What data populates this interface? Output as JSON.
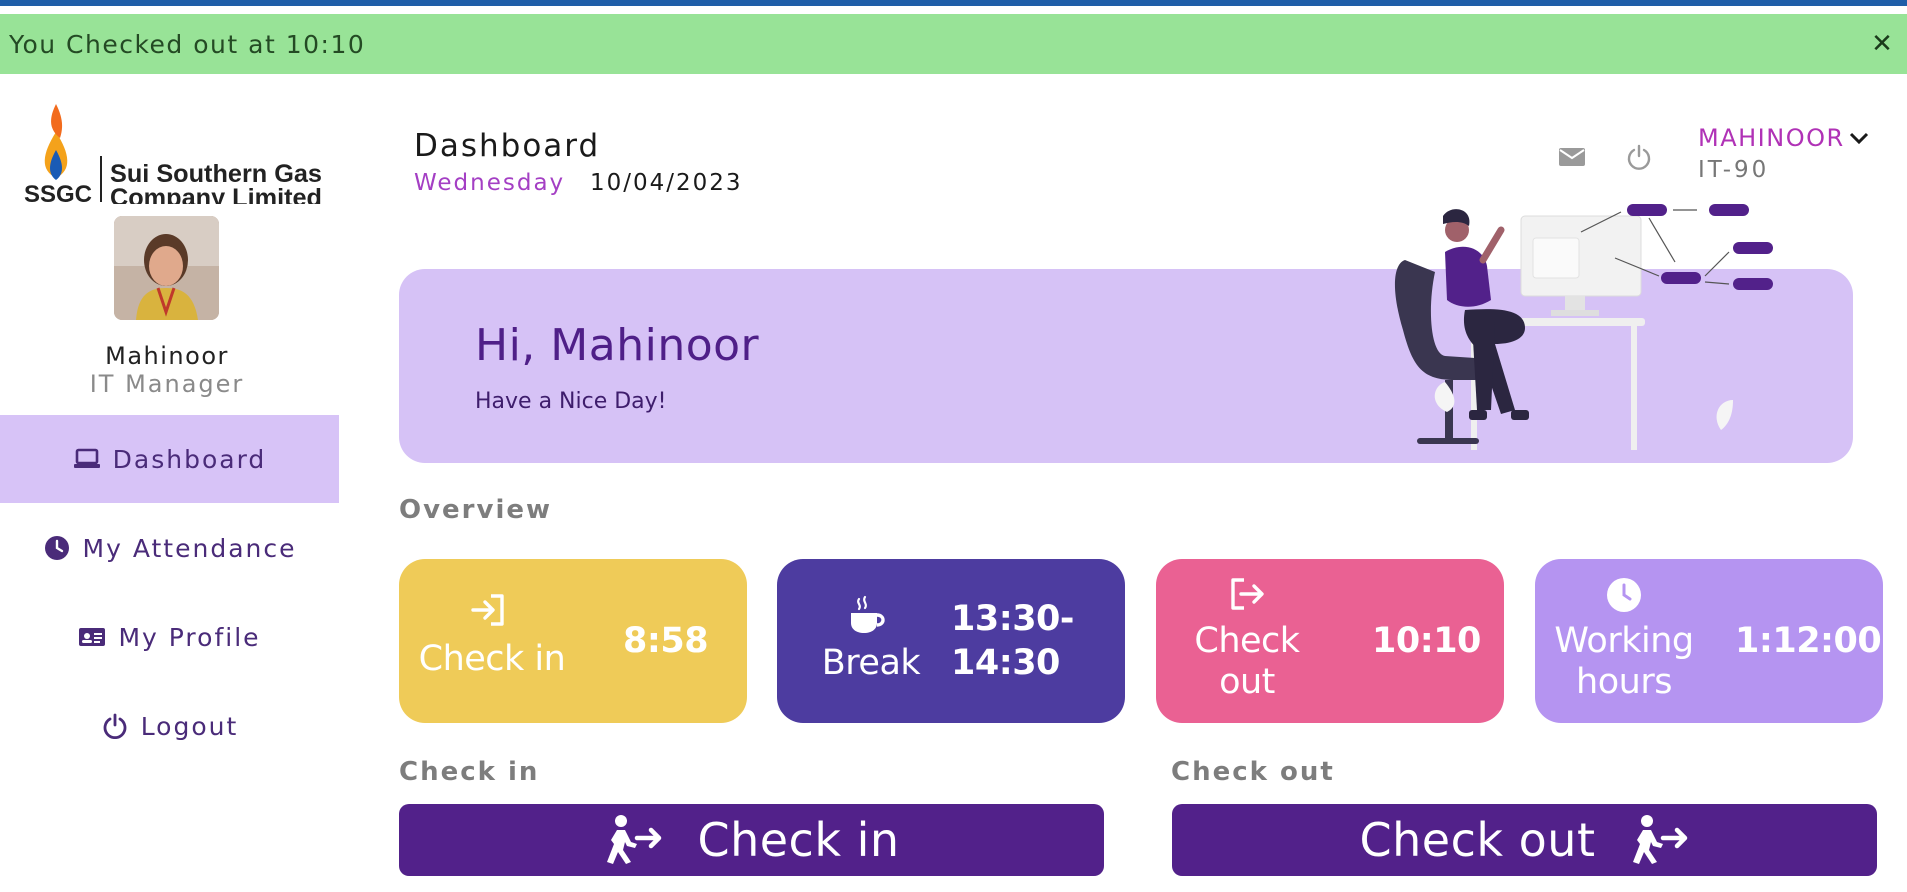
{
  "alert": {
    "message": "You Checked out at 10:10",
    "close_label": "✕"
  },
  "sidebar": {
    "logo": {
      "abbr": "SSGC",
      "line1": "Sui Southern Gas",
      "line2": "Company Limited"
    },
    "user_name": "Mahinoor",
    "user_role": "IT Manager",
    "items": [
      {
        "label": "Dashboard",
        "icon": "laptop-icon",
        "active": true
      },
      {
        "label": "My Attendance",
        "icon": "clock-icon",
        "active": false
      },
      {
        "label": "My Profile",
        "icon": "id-card-icon",
        "active": false
      },
      {
        "label": "Logout",
        "icon": "power-icon",
        "active": false
      }
    ]
  },
  "header": {
    "title": "Dashboard",
    "day": "Wednesday",
    "date": "10/04/2023",
    "user_name": "MAHINOOR",
    "user_id": "IT-90"
  },
  "hero": {
    "greeting": "Hi, Mahinoor",
    "subtitle": "Have a Nice Day!"
  },
  "overview": {
    "title": "Overview",
    "cards": [
      {
        "label": "Check in",
        "value": "8:58",
        "icon": "sign-in-icon",
        "color": "#efcb58"
      },
      {
        "label": "Break",
        "value_line1": "13:30-",
        "value_line2": "14:30",
        "icon": "coffee-icon",
        "color": "#4d3ca0"
      },
      {
        "label_line1": "Check",
        "label_line2": "out",
        "value": "10:10",
        "icon": "sign-out-icon",
        "color": "#ea6193"
      },
      {
        "label_line1": "Working",
        "label_line2": "hours",
        "value": "1:12:00",
        "icon": "clock-icon",
        "color": "#b594f1"
      }
    ]
  },
  "actions": {
    "checkin_section": "Check in",
    "checkout_section": "Check out",
    "checkin_button": "Check in",
    "checkout_button": "Check out"
  },
  "colors": {
    "accent": "#52218a",
    "active_nav": "#d7c3f7",
    "alert_bg": "#98e397",
    "hero_bg": "#d6c2f6"
  }
}
